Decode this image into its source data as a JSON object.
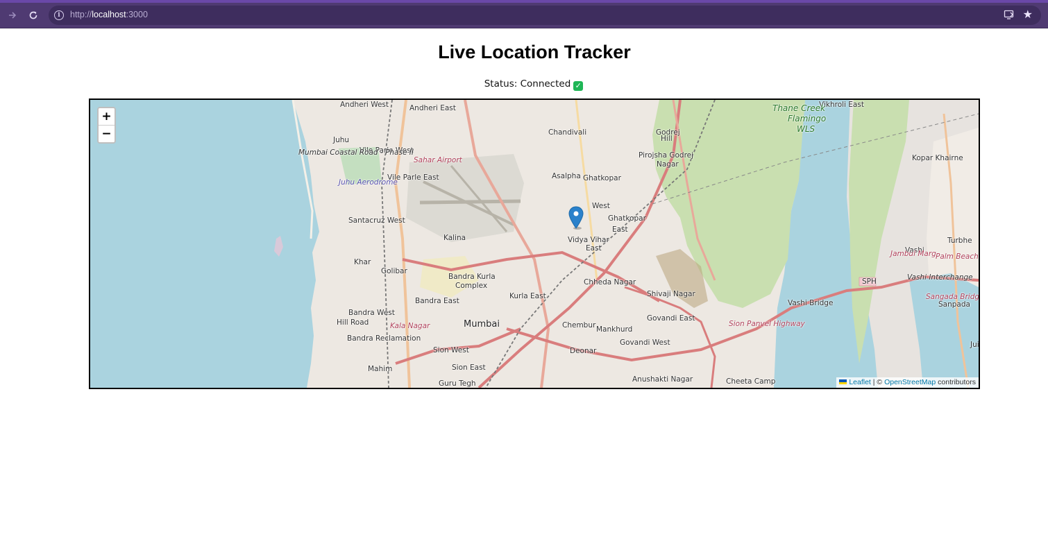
{
  "browser": {
    "url_scheme": "http://",
    "url_host": "localhost",
    "url_port": ":3000",
    "theme_color": "#4f3a72"
  },
  "page": {
    "title": "Live Location Tracker",
    "status_label": "Status: Connected",
    "status_icon": "check-mark-icon",
    "status_color": "#1fb656"
  },
  "map": {
    "zoom_in_label": "+",
    "zoom_out_label": "−",
    "attribution": {
      "leaflet": "Leaflet",
      "separator": " | © ",
      "osm": "OpenStreetMap",
      "suffix": " contributors"
    },
    "places": [
      "Andheri West",
      "Andheri East",
      "Vikhroli East",
      "Thane Creek",
      "Flamingo",
      "WLS",
      "Juhu",
      "Vile Parle West",
      "Chandivali",
      "Godrej",
      "Hill",
      "Pirojsha Godrej",
      "Nagar",
      "Sahar Airport",
      "Juhu Aerodrome",
      "Vile Parle East",
      "Asalpha",
      "Kopar Khairne",
      "Ghatkopar",
      "West",
      "Ghatkopar",
      "East",
      "Santacruz West",
      "Vidya Vihar",
      "East",
      "Kalina",
      "Vashi",
      "Turbhe",
      "Khar",
      "Golibar",
      "Bandra Kurla",
      "Complex",
      "Chheda Nagar",
      "Shivaji Nagar",
      "Kurla East",
      "Bandra East",
      "Bandra West",
      "Mumbai",
      "Chembur",
      "Govandi East",
      "Mankhurd",
      "Vashi Bridge",
      "Sanpada",
      "Bandra Reclamation",
      "Govandi West",
      "Sion West",
      "Deonar",
      "Juinag",
      "Mahim",
      "Sion East",
      "Anushakti Nagar",
      "Cheeta Camp",
      "Guru Tegh",
      "SPH",
      "Hill Road",
      "Kala Nagar",
      "Jambul Marg",
      "Vashi Interchange",
      "Sangada Bridge",
      "Palm Beach Marg",
      "Sion Panvel Highway",
      "Mumbai Coastal Road - Phase II"
    ]
  }
}
